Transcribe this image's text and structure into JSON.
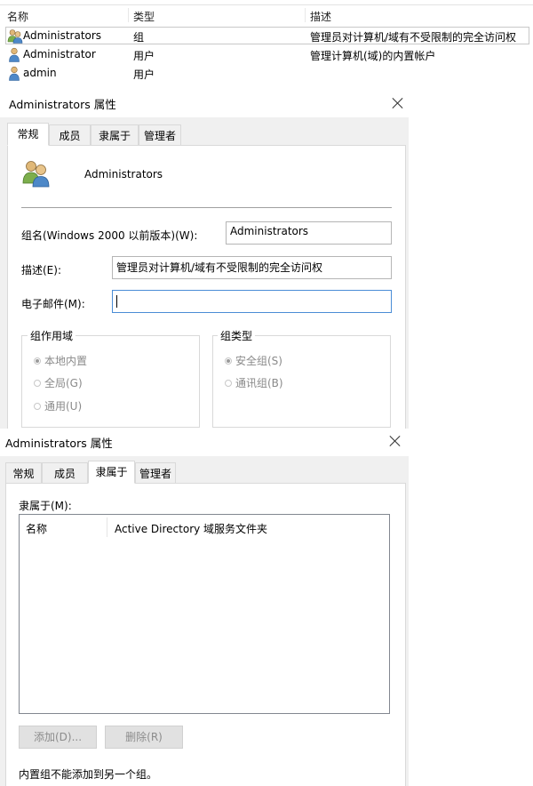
{
  "list": {
    "columns": [
      "名称",
      "类型",
      "描述"
    ],
    "rows": [
      {
        "icon": "group-icon",
        "name": "Administrators",
        "type": "组",
        "desc": "管理员对计算机/域有不受限制的完全访问权"
      },
      {
        "icon": "user-icon",
        "name": "Administrator",
        "type": "用户",
        "desc": "管理计算机(域)的内置帐户"
      },
      {
        "icon": "user-icon",
        "name": "admin",
        "type": "用户",
        "desc": ""
      }
    ]
  },
  "dialog1": {
    "title": "Administrators 属性",
    "tabs": [
      "常规",
      "成员",
      "隶属于",
      "管理者"
    ],
    "active_tab": "常规",
    "group_name_display": "Administrators",
    "fields": {
      "group_name_label": "组名(Windows 2000 以前版本)(W):",
      "group_name_value": "Administrators",
      "desc_label": "描述(E):",
      "desc_value": "管理员对计算机/域有不受限制的完全访问权",
      "email_label": "电子邮件(M):",
      "email_value": ""
    },
    "scope": {
      "title": "组作用域",
      "options": [
        "本地内置",
        "全局(G)",
        "通用(U)"
      ],
      "selected": "本地内置"
    },
    "type": {
      "title": "组类型",
      "options": [
        "安全组(S)",
        "通讯组(B)"
      ],
      "selected": "安全组(S)"
    }
  },
  "dialog2": {
    "title": "Administrators 属性",
    "tabs": [
      "常规",
      "成员",
      "隶属于",
      "管理者"
    ],
    "active_tab": "隶属于",
    "member_of_label": "隶属于(M):",
    "list_columns": [
      "名称",
      "Active Directory 域服务文件夹"
    ],
    "add_button": "添加(D)...",
    "remove_button": "删除(R)",
    "note": "内置组不能添加到另一个组。"
  },
  "colors": {
    "window_bg": "#f0f0f0",
    "focus_border": "#4a8dd6",
    "disabled_text": "#8a8a8a"
  }
}
